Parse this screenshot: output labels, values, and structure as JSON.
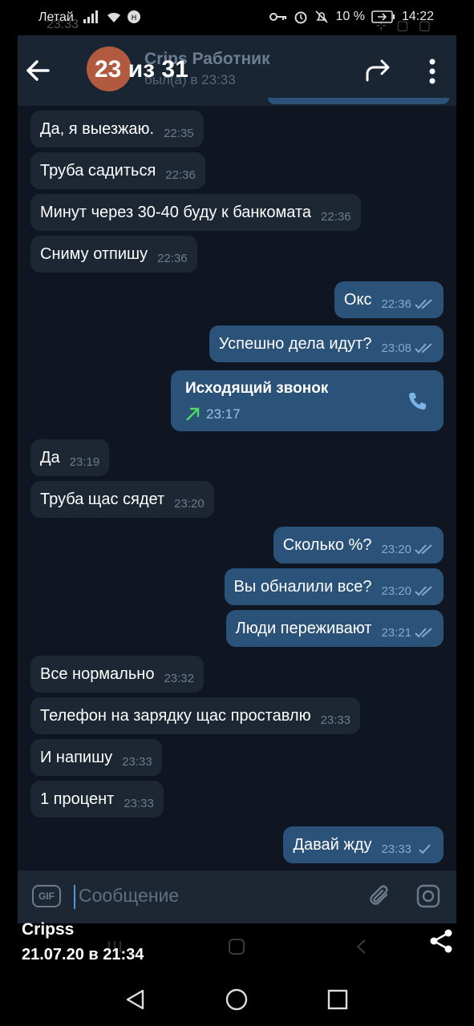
{
  "status_bar": {
    "carrier": "Летай",
    "battery": "10 %",
    "time": "14:22",
    "ghost_time": "23:33"
  },
  "viewer": {
    "counter": "23 из 31",
    "caption_name": "Cripss",
    "caption_date": "21.07.20 в 21:34"
  },
  "chat": {
    "contact_name": "Crips Работник",
    "last_seen": "был(а) в 23:33",
    "avatar_color": "#b25a3f"
  },
  "messages": [
    {
      "dir": "in",
      "text": "Да, я выезжаю.",
      "time": "22:35"
    },
    {
      "dir": "in",
      "text": "Труба садиться",
      "time": "22:36"
    },
    {
      "dir": "in",
      "text": "Минут через 30-40 буду к банкомата",
      "time": "22:36"
    },
    {
      "dir": "in",
      "text": "Сниму отпишу",
      "time": "22:36"
    },
    {
      "dir": "out",
      "text": "Окс",
      "time": "22:36",
      "status": "read"
    },
    {
      "dir": "out",
      "text": "Успешно дела идут?",
      "time": "23:08",
      "status": "read"
    },
    {
      "dir": "in",
      "text": "Да",
      "time": "23:19"
    },
    {
      "dir": "in",
      "text": "Труба щас сядет",
      "time": "23:20"
    },
    {
      "dir": "out",
      "text": "Сколько %?",
      "time": "23:20",
      "status": "read"
    },
    {
      "dir": "out",
      "text": "Вы обналили все?",
      "time": "23:20",
      "status": "read"
    },
    {
      "dir": "out",
      "text": "Люди переживают",
      "time": "23:21",
      "status": "read"
    },
    {
      "dir": "in",
      "text": "Все нормально",
      "time": "23:32"
    },
    {
      "dir": "in",
      "text": "Телефон на зарядку щас проставлю",
      "time": "23:33"
    },
    {
      "dir": "in",
      "text": "И напишу",
      "time": "23:33"
    },
    {
      "dir": "in",
      "text": "1 процент",
      "time": "23:33"
    },
    {
      "dir": "out",
      "text": "Давай жду",
      "time": "23:33",
      "status": "sent"
    }
  ],
  "call": {
    "title": "Исходящий звонок",
    "time": "23:17",
    "icon": "phone-icon"
  },
  "composer": {
    "placeholder": "Сообщение",
    "gif_label": "GIF"
  },
  "colors": {
    "background": "#0f1621",
    "incoming_bubble": "#1d2733",
    "outgoing_bubble": "#2b5278",
    "read_tick": "#84a9d1",
    "call_arrow": "#4cd964"
  }
}
